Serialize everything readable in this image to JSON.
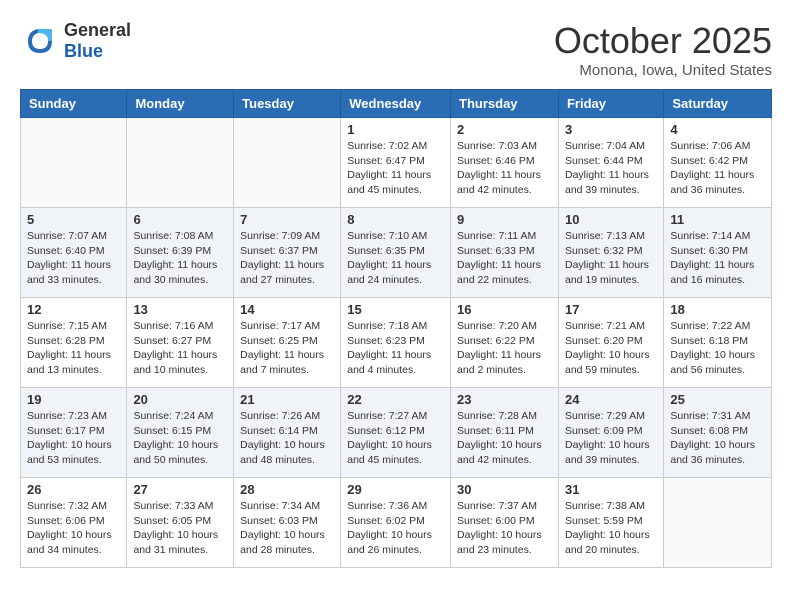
{
  "header": {
    "logo_general": "General",
    "logo_blue": "Blue",
    "month_title": "October 2025",
    "location": "Monona, Iowa, United States"
  },
  "days_of_week": [
    "Sunday",
    "Monday",
    "Tuesday",
    "Wednesday",
    "Thursday",
    "Friday",
    "Saturday"
  ],
  "weeks": [
    [
      {
        "day": "",
        "content": ""
      },
      {
        "day": "",
        "content": ""
      },
      {
        "day": "",
        "content": ""
      },
      {
        "day": "1",
        "content": "Sunrise: 7:02 AM\nSunset: 6:47 PM\nDaylight: 11 hours and 45 minutes."
      },
      {
        "day": "2",
        "content": "Sunrise: 7:03 AM\nSunset: 6:46 PM\nDaylight: 11 hours and 42 minutes."
      },
      {
        "day": "3",
        "content": "Sunrise: 7:04 AM\nSunset: 6:44 PM\nDaylight: 11 hours and 39 minutes."
      },
      {
        "day": "4",
        "content": "Sunrise: 7:06 AM\nSunset: 6:42 PM\nDaylight: 11 hours and 36 minutes."
      }
    ],
    [
      {
        "day": "5",
        "content": "Sunrise: 7:07 AM\nSunset: 6:40 PM\nDaylight: 11 hours and 33 minutes."
      },
      {
        "day": "6",
        "content": "Sunrise: 7:08 AM\nSunset: 6:39 PM\nDaylight: 11 hours and 30 minutes."
      },
      {
        "day": "7",
        "content": "Sunrise: 7:09 AM\nSunset: 6:37 PM\nDaylight: 11 hours and 27 minutes."
      },
      {
        "day": "8",
        "content": "Sunrise: 7:10 AM\nSunset: 6:35 PM\nDaylight: 11 hours and 24 minutes."
      },
      {
        "day": "9",
        "content": "Sunrise: 7:11 AM\nSunset: 6:33 PM\nDaylight: 11 hours and 22 minutes."
      },
      {
        "day": "10",
        "content": "Sunrise: 7:13 AM\nSunset: 6:32 PM\nDaylight: 11 hours and 19 minutes."
      },
      {
        "day": "11",
        "content": "Sunrise: 7:14 AM\nSunset: 6:30 PM\nDaylight: 11 hours and 16 minutes."
      }
    ],
    [
      {
        "day": "12",
        "content": "Sunrise: 7:15 AM\nSunset: 6:28 PM\nDaylight: 11 hours and 13 minutes."
      },
      {
        "day": "13",
        "content": "Sunrise: 7:16 AM\nSunset: 6:27 PM\nDaylight: 11 hours and 10 minutes."
      },
      {
        "day": "14",
        "content": "Sunrise: 7:17 AM\nSunset: 6:25 PM\nDaylight: 11 hours and 7 minutes."
      },
      {
        "day": "15",
        "content": "Sunrise: 7:18 AM\nSunset: 6:23 PM\nDaylight: 11 hours and 4 minutes."
      },
      {
        "day": "16",
        "content": "Sunrise: 7:20 AM\nSunset: 6:22 PM\nDaylight: 11 hours and 2 minutes."
      },
      {
        "day": "17",
        "content": "Sunrise: 7:21 AM\nSunset: 6:20 PM\nDaylight: 10 hours and 59 minutes."
      },
      {
        "day": "18",
        "content": "Sunrise: 7:22 AM\nSunset: 6:18 PM\nDaylight: 10 hours and 56 minutes."
      }
    ],
    [
      {
        "day": "19",
        "content": "Sunrise: 7:23 AM\nSunset: 6:17 PM\nDaylight: 10 hours and 53 minutes."
      },
      {
        "day": "20",
        "content": "Sunrise: 7:24 AM\nSunset: 6:15 PM\nDaylight: 10 hours and 50 minutes."
      },
      {
        "day": "21",
        "content": "Sunrise: 7:26 AM\nSunset: 6:14 PM\nDaylight: 10 hours and 48 minutes."
      },
      {
        "day": "22",
        "content": "Sunrise: 7:27 AM\nSunset: 6:12 PM\nDaylight: 10 hours and 45 minutes."
      },
      {
        "day": "23",
        "content": "Sunrise: 7:28 AM\nSunset: 6:11 PM\nDaylight: 10 hours and 42 minutes."
      },
      {
        "day": "24",
        "content": "Sunrise: 7:29 AM\nSunset: 6:09 PM\nDaylight: 10 hours and 39 minutes."
      },
      {
        "day": "25",
        "content": "Sunrise: 7:31 AM\nSunset: 6:08 PM\nDaylight: 10 hours and 36 minutes."
      }
    ],
    [
      {
        "day": "26",
        "content": "Sunrise: 7:32 AM\nSunset: 6:06 PM\nDaylight: 10 hours and 34 minutes."
      },
      {
        "day": "27",
        "content": "Sunrise: 7:33 AM\nSunset: 6:05 PM\nDaylight: 10 hours and 31 minutes."
      },
      {
        "day": "28",
        "content": "Sunrise: 7:34 AM\nSunset: 6:03 PM\nDaylight: 10 hours and 28 minutes."
      },
      {
        "day": "29",
        "content": "Sunrise: 7:36 AM\nSunset: 6:02 PM\nDaylight: 10 hours and 26 minutes."
      },
      {
        "day": "30",
        "content": "Sunrise: 7:37 AM\nSunset: 6:00 PM\nDaylight: 10 hours and 23 minutes."
      },
      {
        "day": "31",
        "content": "Sunrise: 7:38 AM\nSunset: 5:59 PM\nDaylight: 10 hours and 20 minutes."
      },
      {
        "day": "",
        "content": ""
      }
    ]
  ]
}
